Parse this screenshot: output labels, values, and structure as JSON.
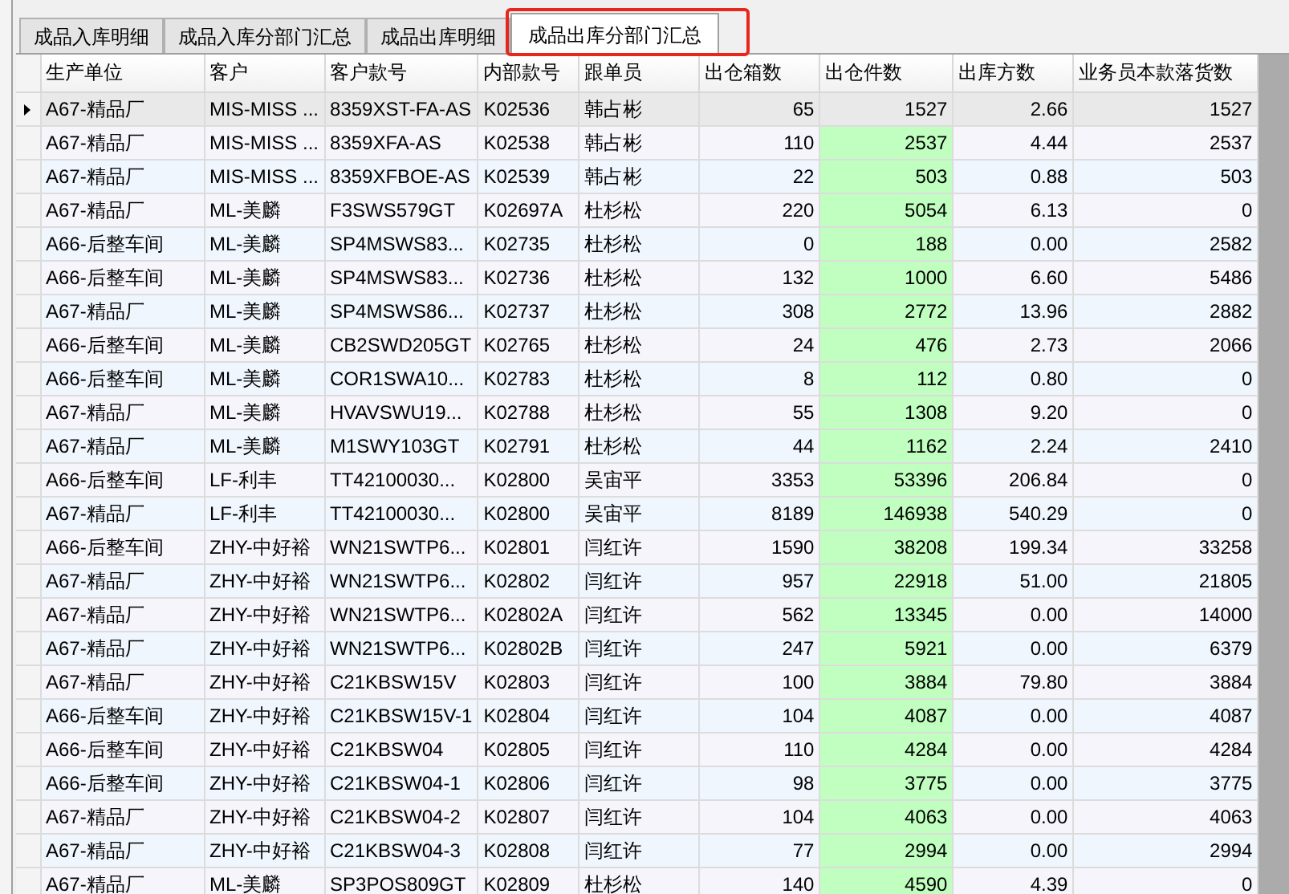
{
  "tabs": [
    {
      "label": "成品入库明细",
      "selected": false,
      "outlined": false
    },
    {
      "label": "成品入库分部门汇总",
      "selected": false,
      "outlined": false
    },
    {
      "label": "成品出库明细",
      "selected": false,
      "outlined": false
    },
    {
      "label": "成品出库分部门汇总",
      "selected": true,
      "outlined": true
    }
  ],
  "table": {
    "columns": [
      {
        "label": "生产单位",
        "kind": "text",
        "highlighted": false
      },
      {
        "label": "客户",
        "kind": "text",
        "highlighted": false
      },
      {
        "label": "客户款号",
        "kind": "text",
        "highlighted": false
      },
      {
        "label": "内部款号",
        "kind": "text",
        "highlighted": false
      },
      {
        "label": "跟单员",
        "kind": "text",
        "highlighted": false
      },
      {
        "label": "出仓箱数",
        "kind": "number",
        "highlighted": false
      },
      {
        "label": "出仓件数",
        "kind": "number",
        "highlighted": true
      },
      {
        "label": "出库方数",
        "kind": "number",
        "highlighted": false
      },
      {
        "label": "业务员本款落货数",
        "kind": "number",
        "highlighted": false
      }
    ],
    "rows": [
      {
        "selected": true,
        "cells": [
          "A67-精品厂",
          "MIS-MISS ...",
          "8359XST-FA-AS",
          "K02536",
          "韩占彬",
          "65",
          "1527",
          "2.66",
          "1527"
        ]
      },
      {
        "selected": false,
        "cells": [
          "A67-精品厂",
          "MIS-MISS ...",
          "8359XFA-AS",
          "K02538",
          "韩占彬",
          "110",
          "2537",
          "4.44",
          "2537"
        ]
      },
      {
        "selected": false,
        "cells": [
          "A67-精品厂",
          "MIS-MISS ...",
          "8359XFBOE-AS",
          "K02539",
          "韩占彬",
          "22",
          "503",
          "0.88",
          "503"
        ]
      },
      {
        "selected": false,
        "cells": [
          "A67-精品厂",
          "ML-美麟",
          "F3SWS579GT",
          "K02697A",
          "杜杉松",
          "220",
          "5054",
          "6.13",
          "0"
        ]
      },
      {
        "selected": false,
        "cells": [
          "A66-后整车间",
          "ML-美麟",
          "SP4MSWS83...",
          "K02735",
          "杜杉松",
          "0",
          "188",
          "0.00",
          "2582"
        ]
      },
      {
        "selected": false,
        "cells": [
          "A66-后整车间",
          "ML-美麟",
          "SP4MSWS83...",
          "K02736",
          "杜杉松",
          "132",
          "1000",
          "6.60",
          "5486"
        ]
      },
      {
        "selected": false,
        "cells": [
          "A67-精品厂",
          "ML-美麟",
          "SP4MSWS86...",
          "K02737",
          "杜杉松",
          "308",
          "2772",
          "13.96",
          "2882"
        ]
      },
      {
        "selected": false,
        "cells": [
          "A66-后整车间",
          "ML-美麟",
          "CB2SWD205GT",
          "K02765",
          "杜杉松",
          "24",
          "476",
          "2.73",
          "2066"
        ]
      },
      {
        "selected": false,
        "cells": [
          "A66-后整车间",
          "ML-美麟",
          "COR1SWA10...",
          "K02783",
          "杜杉松",
          "8",
          "112",
          "0.80",
          "0"
        ]
      },
      {
        "selected": false,
        "cells": [
          "A67-精品厂",
          "ML-美麟",
          "HVAVSWU19...",
          "K02788",
          "杜杉松",
          "55",
          "1308",
          "9.20",
          "0"
        ]
      },
      {
        "selected": false,
        "cells": [
          "A67-精品厂",
          "ML-美麟",
          "M1SWY103GT",
          "K02791",
          "杜杉松",
          "44",
          "1162",
          "2.24",
          "2410"
        ]
      },
      {
        "selected": false,
        "cells": [
          "A66-后整车间",
          "LF-利丰",
          "TT42100030...",
          "K02800",
          "吴宙平",
          "3353",
          "53396",
          "206.84",
          "0"
        ]
      },
      {
        "selected": false,
        "cells": [
          "A67-精品厂",
          "LF-利丰",
          "TT42100030...",
          "K02800",
          "吴宙平",
          "8189",
          "146938",
          "540.29",
          "0"
        ]
      },
      {
        "selected": false,
        "cells": [
          "A66-后整车间",
          "ZHY-中好裕",
          "WN21SWTP6...",
          "K02801",
          "闫红许",
          "1590",
          "38208",
          "199.34",
          "33258"
        ]
      },
      {
        "selected": false,
        "cells": [
          "A67-精品厂",
          "ZHY-中好裕",
          "WN21SWTP6...",
          "K02802",
          "闫红许",
          "957",
          "22918",
          "51.00",
          "21805"
        ]
      },
      {
        "selected": false,
        "cells": [
          "A67-精品厂",
          "ZHY-中好裕",
          "WN21SWTP6...",
          "K02802A",
          "闫红许",
          "562",
          "13345",
          "0.00",
          "14000"
        ]
      },
      {
        "selected": false,
        "cells": [
          "A67-精品厂",
          "ZHY-中好裕",
          "WN21SWTP6...",
          "K02802B",
          "闫红许",
          "247",
          "5921",
          "0.00",
          "6379"
        ]
      },
      {
        "selected": false,
        "cells": [
          "A67-精品厂",
          "ZHY-中好裕",
          "C21KBSW15V",
          "K02803",
          "闫红许",
          "100",
          "3884",
          "79.80",
          "3884"
        ]
      },
      {
        "selected": false,
        "cells": [
          "A66-后整车间",
          "ZHY-中好裕",
          "C21KBSW15V-1",
          "K02804",
          "闫红许",
          "104",
          "4087",
          "0.00",
          "4087"
        ]
      },
      {
        "selected": false,
        "cells": [
          "A66-后整车间",
          "ZHY-中好裕",
          "C21KBSW04",
          "K02805",
          "闫红许",
          "110",
          "4284",
          "0.00",
          "4284"
        ]
      },
      {
        "selected": false,
        "cells": [
          "A66-后整车间",
          "ZHY-中好裕",
          "C21KBSW04-1",
          "K02806",
          "闫红许",
          "98",
          "3775",
          "0.00",
          "3775"
        ]
      },
      {
        "selected": false,
        "cells": [
          "A67-精品厂",
          "ZHY-中好裕",
          "C21KBSW04-2",
          "K02807",
          "闫红许",
          "104",
          "4063",
          "0.00",
          "4063"
        ]
      },
      {
        "selected": false,
        "cells": [
          "A67-精品厂",
          "ZHY-中好裕",
          "C21KBSW04-3",
          "K02808",
          "闫红许",
          "77",
          "2994",
          "0.00",
          "2994"
        ]
      },
      {
        "selected": false,
        "cells": [
          "A67-精品厂",
          "ML-美麟",
          "SP3POS809GT",
          "K02809",
          "杜杉松",
          "140",
          "4590",
          "4.39",
          "0"
        ]
      }
    ]
  }
}
